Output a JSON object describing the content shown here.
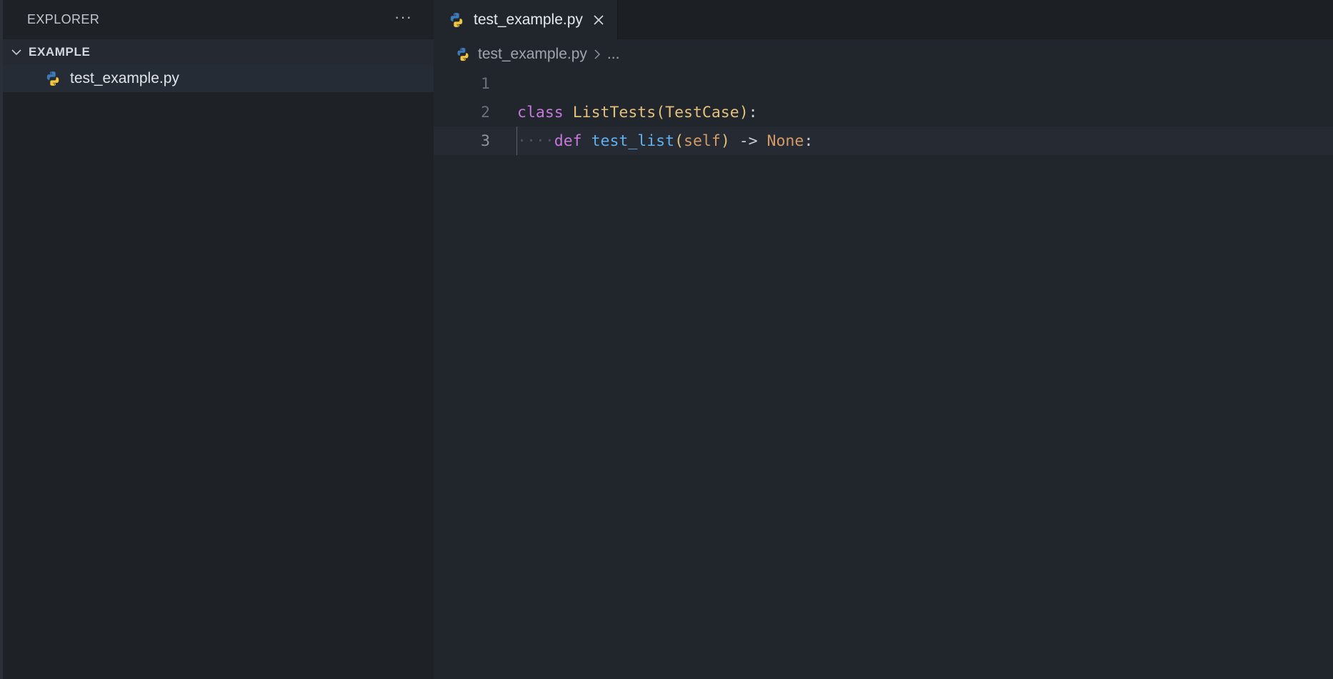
{
  "sidebar": {
    "title": "EXPLORER",
    "more_label": "···",
    "section_label": "EXAMPLE",
    "files": [
      {
        "label": "test_example.py",
        "icon": "python-file-icon"
      }
    ]
  },
  "tabs": [
    {
      "label": "test_example.py",
      "icon": "python-file-icon",
      "active": true
    }
  ],
  "breadcrumb": {
    "file": "test_example.py",
    "separator": ">",
    "more": "..."
  },
  "code": {
    "lines": [
      {
        "number": "1",
        "tokens": []
      },
      {
        "number": "2",
        "tokens": [
          {
            "text": "class",
            "kind": "kw"
          },
          {
            "text": " ",
            "kind": "plain"
          },
          {
            "text": "ListTests",
            "kind": "cls"
          },
          {
            "text": "(",
            "kind": "paren"
          },
          {
            "text": "TestCase",
            "kind": "cls"
          },
          {
            "text": ")",
            "kind": "paren"
          },
          {
            "text": ":",
            "kind": "colon"
          }
        ]
      },
      {
        "number": "3",
        "tokens": [
          {
            "text": "····",
            "kind": "ws-dots"
          },
          {
            "text": "def",
            "kind": "kw"
          },
          {
            "text": " ",
            "kind": "plain"
          },
          {
            "text": "test_list",
            "kind": "fn"
          },
          {
            "text": "(",
            "kind": "paren"
          },
          {
            "text": "self",
            "kind": "self"
          },
          {
            "text": ")",
            "kind": "paren"
          },
          {
            "text": " -> ",
            "kind": "arrow"
          },
          {
            "text": "None",
            "kind": "none"
          },
          {
            "text": ":",
            "kind": "colon"
          }
        ]
      }
    ]
  },
  "colors": {
    "keyword": "#c678dd",
    "class": "#e5c07b",
    "function": "#61afef",
    "self": "#d19a66",
    "none": "#d19a66",
    "background": "#21262c"
  }
}
